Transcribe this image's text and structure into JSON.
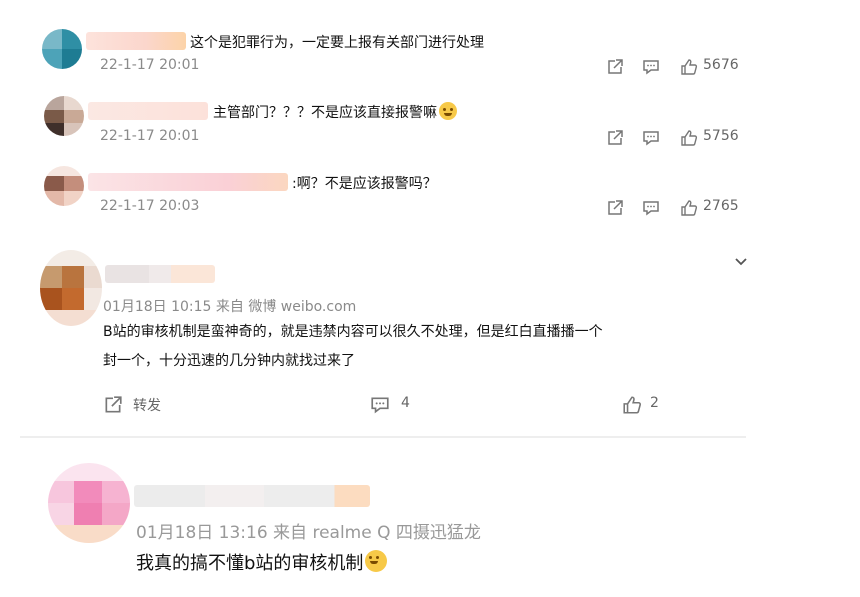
{
  "replies": [
    {
      "text": "这个是犯罪行为，一定要上报有关部门进行处理",
      "time": "22-1-17 20:01",
      "likes": "5676"
    },
    {
      "text": "主管部门？？？不是应该直接报警嘛",
      "time": "22-1-17 20:01",
      "likes": "5756"
    },
    {
      "text": ":啊？不是应该报警吗？",
      "time": "22-1-17 20:03",
      "likes": "2765"
    }
  ],
  "comment2": {
    "meta": "01月18日 10:15  来自 微博 weibo.com",
    "line1": "B站的审核机制是蛮神奇的，就是违禁内容可以很久不处理，但是红白直播播一个",
    "line2": "封一个，十分迅速的几分钟内就找过来了",
    "repost_label": "转发",
    "comment_count": "4",
    "like_count": "2"
  },
  "comment3": {
    "meta": "01月18日 13:16  来自 realme Q 四摄迅猛龙",
    "text": "我真的搞不懂b站的审核机制"
  },
  "icons": {
    "share": "share-icon",
    "comment": "comment-icon",
    "like": "thumbs-up-icon",
    "expand": "chevron-down-icon"
  }
}
